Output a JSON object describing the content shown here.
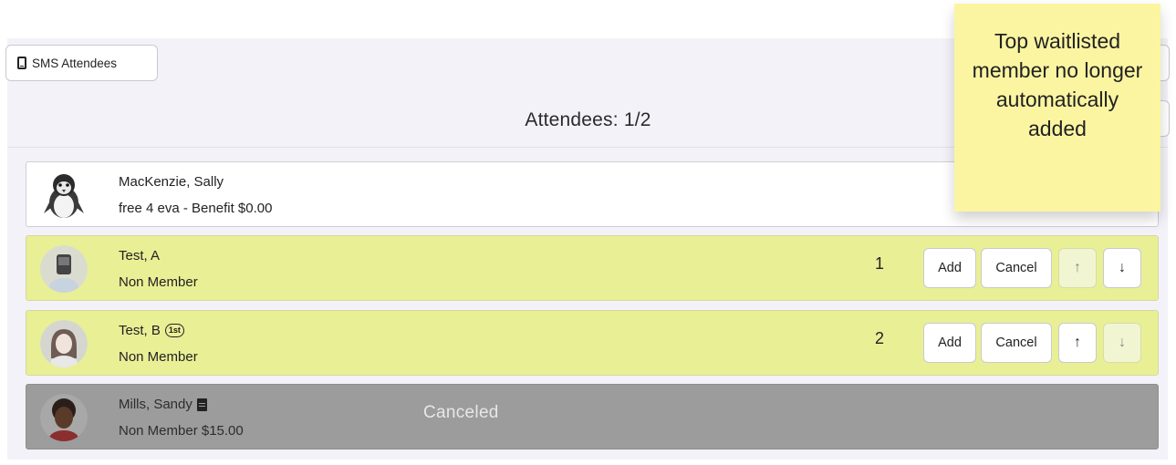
{
  "toolbar": {
    "sms_label": "SMS Attendees",
    "sms_icon": "phone-icon"
  },
  "title": "Attendees: 1/2",
  "attendees": [
    {
      "name": "MacKenzie, Sally",
      "detail": "free 4 eva - Benefit $0.00",
      "status": "registered",
      "avatar": "penguin"
    },
    {
      "name": "Test, A",
      "detail": "Non Member",
      "status": "waitlisted",
      "position": "1",
      "add": "Add",
      "cancel": "Cancel",
      "up": "↑",
      "down": "↓"
    },
    {
      "name": "Test, B",
      "badge": "1st",
      "detail": "Non Member",
      "status": "waitlisted",
      "position": "2",
      "add": "Add",
      "cancel": "Cancel",
      "up": "↑",
      "down": "↓"
    },
    {
      "name": "Mills, Sandy",
      "detail": "Non Member $15.00",
      "status": "canceled",
      "status_label": "Canceled",
      "icon": "document-icon"
    }
  ],
  "sticky_note": "Top waitlisted member no longer automatically added",
  "colors": {
    "waitlist_bg": "#e9ef95",
    "canceled_bg": "#9c9c9c",
    "note_bg": "#fbf5a2",
    "panel_bg": "#f3f2f8"
  }
}
